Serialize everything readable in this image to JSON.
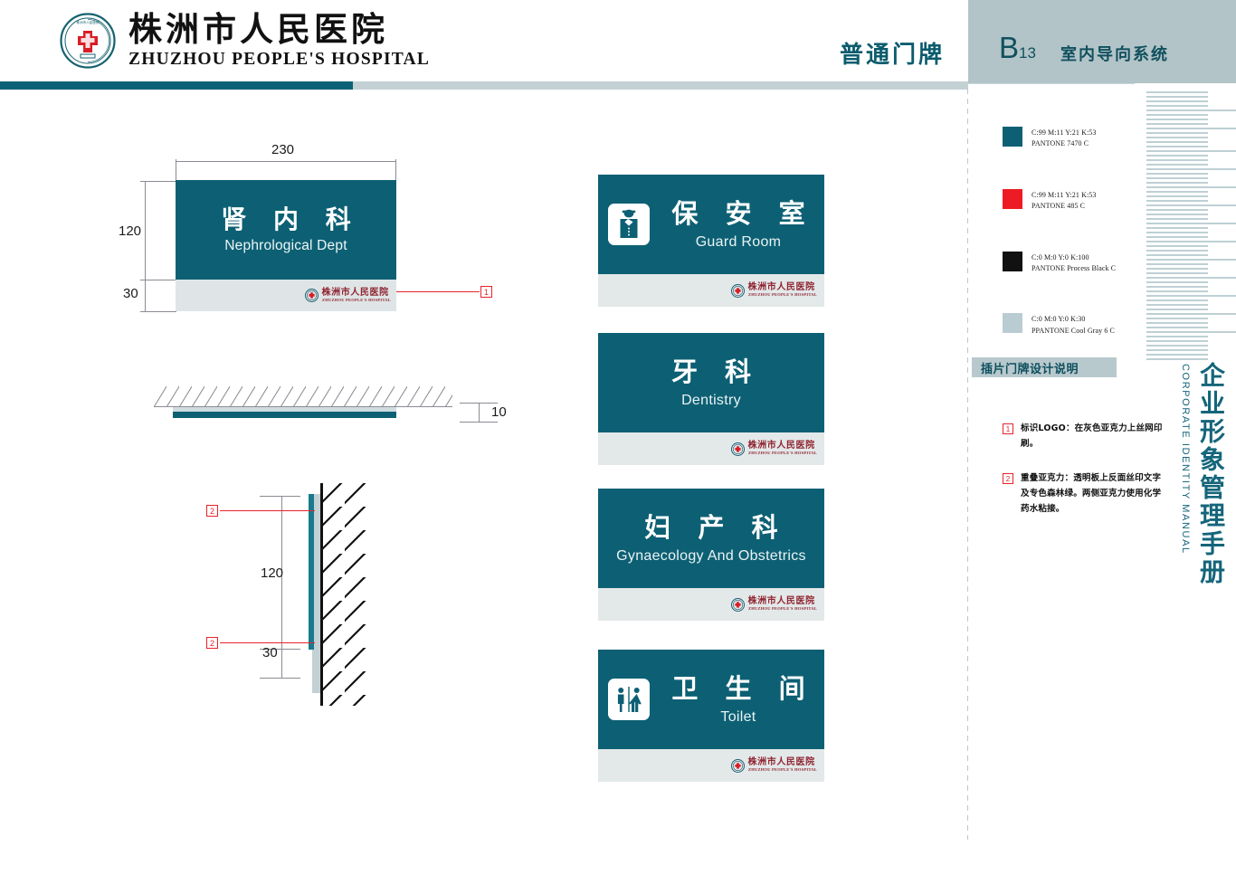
{
  "header": {
    "hospital_cn": "株洲市人民医院",
    "hospital_en": "ZHUZHOU PEOPLE'S HOSPITAL",
    "doc_type": "普通门牌",
    "section_code": "B",
    "section_code_sub": "13",
    "section_title": "室内导向系统",
    "seal_icon": "hospital-seal-icon"
  },
  "drawing": {
    "width_label": "230",
    "height_label": "120",
    "footer_height_label": "30",
    "thickness_label": "10",
    "side_height_label": "120",
    "side_footer_label": "30",
    "callout_1": "1",
    "callout_2a": "2",
    "callout_2b": "2",
    "sample": {
      "cn": "肾 内 科",
      "en": "Nephrological Dept",
      "logo_cn": "株洲市人民医院",
      "logo_en": "ZHUZHOU PEOPLE'S HOSPITAL"
    }
  },
  "examples": [
    {
      "cn": "保 安 室",
      "en": "Guard Room",
      "icon": "security-guard-icon",
      "has_icon": true,
      "logo_cn": "株洲市人民医院",
      "logo_en": "ZHUZHOU PEOPLE'S HOSPITAL"
    },
    {
      "cn": "牙 科",
      "en": "Dentistry",
      "icon": "",
      "has_icon": false,
      "logo_cn": "株洲市人民医院",
      "logo_en": "ZHUZHOU PEOPLE'S HOSPITAL"
    },
    {
      "cn": "妇 产 科",
      "en": "Gynaecology And Obstetrics",
      "icon": "",
      "has_icon": false,
      "logo_cn": "株洲市人民医院",
      "logo_en": "ZHUZHOU PEOPLE'S HOSPITAL"
    },
    {
      "cn": "卫 生 间",
      "en": "Toilet",
      "icon": "restroom-icon",
      "has_icon": true,
      "logo_cn": "株洲市人民医院",
      "logo_en": "ZHUZHOU PEOPLE'S HOSPITAL"
    }
  ],
  "swatches": [
    {
      "hex": "#0d6074",
      "line1": "C:99 M:11 Y:21 K:53",
      "line2": "PANTONE 7470 C"
    },
    {
      "hex": "#ed1c24",
      "line1": "C:99 M:11 Y:21 K:53",
      "line2": "PANTONE 485 C"
    },
    {
      "hex": "#111111",
      "line1": "C:0 M:0 Y:0 K:100",
      "line2": "PANTONE Process Black C"
    },
    {
      "hex": "#b9ccd2",
      "line1": "C:0 M:0 Y:0 K:30",
      "line2": "PPANTONE Cool Gray 6 C"
    }
  ],
  "notes": {
    "title": "插片门牌设计说明",
    "items": [
      {
        "num": "1",
        "text": "标识LOGO：在灰色亚克力上丝网印刷。"
      },
      {
        "num": "2",
        "text": "重叠亚克力：透明板上反面丝印文字及专色森林绿。两侧亚克力使用化学药水粘接。"
      }
    ]
  },
  "vertical": {
    "cn": "企业形象管理手册",
    "en": "CORPORATE IDENTITY MANUAL"
  },
  "colors": {
    "teal": "#0d6074",
    "gray_panel": "#b2c4c8",
    "red": "#e8232a"
  }
}
